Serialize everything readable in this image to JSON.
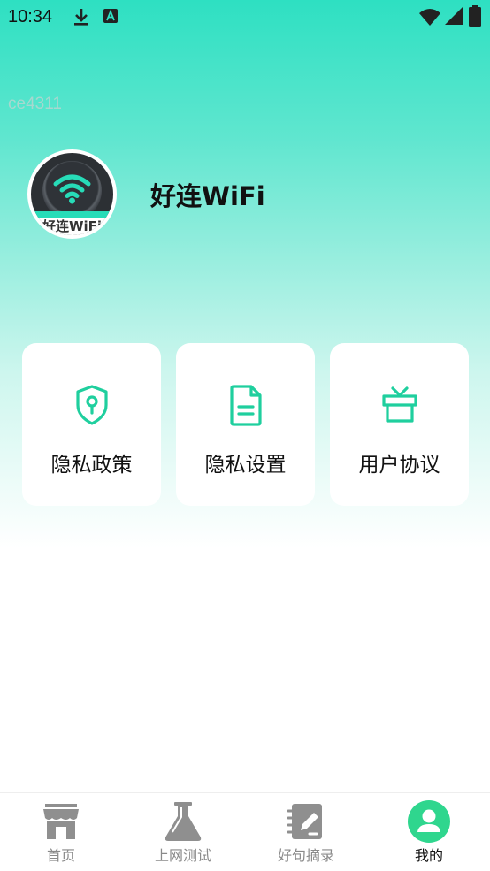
{
  "status_bar": {
    "time": "10:34",
    "icons": [
      "download-icon",
      "a-notification-icon",
      "wifi-icon",
      "signal-icon",
      "battery-icon"
    ]
  },
  "profile": {
    "device_id": "ce4311",
    "avatar_text": "好连WiFi",
    "app_name": "好连WiFi"
  },
  "cards": [
    {
      "label": "隐私政策",
      "icon": "shield-icon"
    },
    {
      "label": "隐私设置",
      "icon": "document-icon"
    },
    {
      "label": "用户协议",
      "icon": "gift-icon"
    }
  ],
  "tabbar": {
    "tabs": [
      {
        "label": "首页",
        "icon": "store-icon",
        "active": false
      },
      {
        "label": "上网测试",
        "icon": "flask-icon",
        "active": false
      },
      {
        "label": "好句摘录",
        "icon": "notebook-icon",
        "active": false
      },
      {
        "label": "我的",
        "icon": "user-icon",
        "active": true
      }
    ]
  },
  "colors": {
    "accent": "#2ee0c2",
    "icon_green": "#1fcf9e",
    "active_tab": "#2fd68e",
    "inactive_tab_icon": "#8f8f8f"
  }
}
